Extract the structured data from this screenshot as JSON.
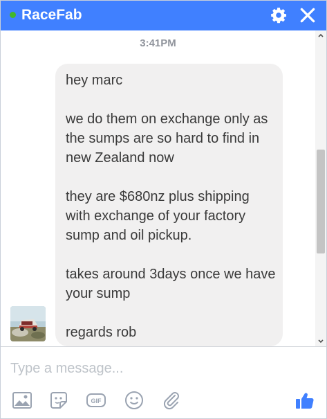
{
  "header": {
    "title": "RaceFab",
    "status": "online",
    "accent_color": "#4080ff",
    "status_color": "#42b72a",
    "icons": [
      "gear-icon",
      "close-icon"
    ]
  },
  "conversation": {
    "timestamp": "3:41PM",
    "message": {
      "paragraphs": [
        "hey marc",
        "we do them on exchange only as the sumps are so hard to find in new Zealand now",
        "they are $680nz plus shipping with exchange of your factory sump and oil pickup.",
        "takes around 3days once we have your sump",
        "regards rob"
      ]
    }
  },
  "composer": {
    "placeholder": "Type a message...",
    "value": "",
    "tools": [
      "photo-icon",
      "sticker-icon",
      "gif-icon",
      "emoji-icon",
      "paperclip-icon",
      "thumbs-up-icon"
    ],
    "gif_label": "GIF",
    "like_color": "#4080ff"
  }
}
